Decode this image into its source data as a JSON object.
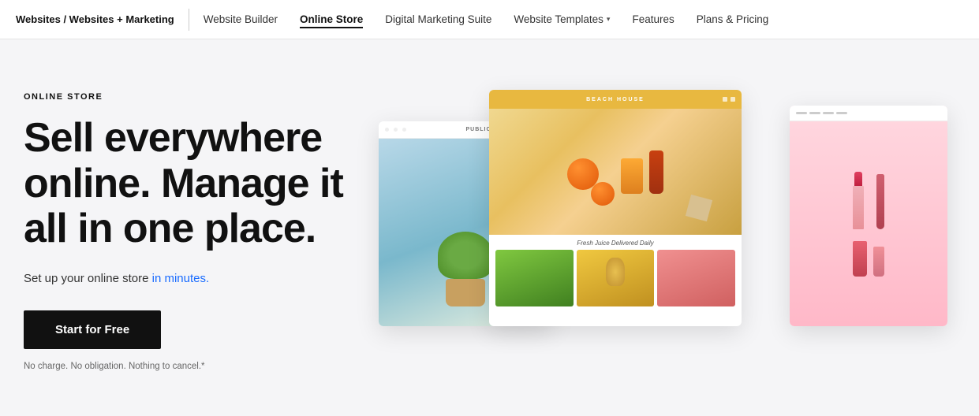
{
  "nav": {
    "brand": "Websites / Websites + Marketing",
    "links": [
      {
        "id": "website-builder",
        "label": "Website Builder",
        "active": false
      },
      {
        "id": "online-store",
        "label": "Online Store",
        "active": true
      },
      {
        "id": "digital-marketing",
        "label": "Digital Marketing Suite",
        "active": false
      },
      {
        "id": "website-templates",
        "label": "Website Templates",
        "active": false,
        "hasArrow": true
      },
      {
        "id": "features",
        "label": "Features",
        "active": false
      },
      {
        "id": "plans-pricing",
        "label": "Plans & Pricing",
        "active": false
      }
    ]
  },
  "hero": {
    "section_label": "ONLINE STORE",
    "headline": "Sell everywhere online. Manage it all in one place.",
    "subtext_part1": "Set up your online store ",
    "subtext_highlight": "in minutes.",
    "cta_label": "Start for Free",
    "disclaimer": "No charge. No obligation. Nothing to cancel.*"
  },
  "mockups": {
    "left_store_name": "PUBLIC",
    "middle_store_name": "BEACH HOUSE",
    "middle_subtitle": "Fresh Juice Delivered Daily",
    "right_store_hint": "cosmetics"
  }
}
